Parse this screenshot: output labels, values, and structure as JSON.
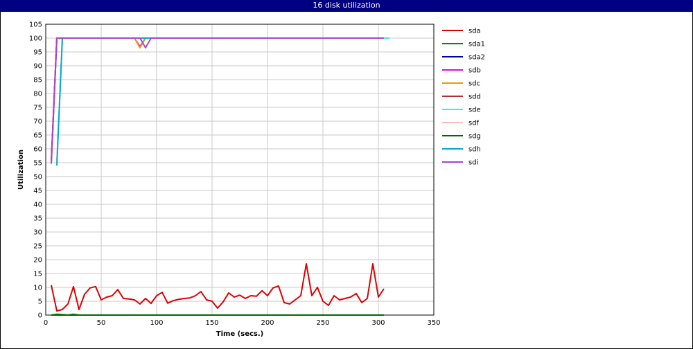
{
  "window": {
    "title": "16 disk utilization"
  },
  "chart_data": {
    "type": "line",
    "title": "16 disk utilization",
    "xlabel": "Time (secs.)",
    "ylabel": "Utilization",
    "xlim": [
      0,
      350
    ],
    "ylim": [
      0,
      105
    ],
    "xticks": [
      0,
      50,
      100,
      150,
      200,
      250,
      300,
      350
    ],
    "yticks": [
      0,
      5,
      10,
      15,
      20,
      25,
      30,
      35,
      40,
      45,
      50,
      55,
      60,
      65,
      70,
      75,
      80,
      85,
      90,
      95,
      100,
      105
    ],
    "grid": true,
    "legend_position": "right",
    "series": [
      {
        "name": "sda",
        "color": "#dd0000",
        "x": [
          5,
          10,
          15,
          20,
          25,
          30,
          35,
          40,
          45,
          50,
          55,
          60,
          65,
          70,
          75,
          80,
          85,
          90,
          95,
          100,
          105,
          110,
          115,
          120,
          125,
          130,
          135,
          140,
          145,
          150,
          155,
          160,
          165,
          170,
          175,
          180,
          185,
          190,
          195,
          200,
          205,
          210,
          215,
          220,
          225,
          230,
          235,
          240,
          245,
          250,
          255,
          260,
          265,
          270,
          275,
          280,
          285,
          290,
          295,
          300,
          305
        ],
        "y": [
          10.8,
          1.5,
          2,
          4,
          10.3,
          2,
          7.5,
          9.8,
          10.3,
          5.5,
          6.5,
          7,
          9.2,
          6,
          5.8,
          5.5,
          4,
          6,
          4.2,
          7,
          8.2,
          4.3,
          5.2,
          5.7,
          6,
          6.2,
          7,
          8.5,
          5.5,
          5,
          2.5,
          4.8,
          8,
          6.5,
          7.2,
          6,
          7,
          6.8,
          8.8,
          7,
          9.8,
          10.5,
          4.5,
          4,
          5.5,
          7,
          18.5,
          7,
          10,
          5,
          3.5,
          7,
          5.5,
          6,
          6.5,
          7.8,
          4.5,
          6,
          18.5,
          6.5,
          9.5
        ]
      },
      {
        "name": "sda1",
        "color": "#008800",
        "x": [
          5,
          10,
          15,
          20,
          25,
          30,
          100,
          200,
          305
        ],
        "y": [
          0,
          0.3,
          0.2,
          0,
          0.3,
          0,
          0,
          0,
          0
        ]
      },
      {
        "name": "sda2",
        "color": "#0000aa",
        "x": [
          5,
          305
        ],
        "y": [
          0,
          0
        ]
      },
      {
        "name": "sdb",
        "color": "#ee00ee",
        "x": [
          5,
          10,
          15,
          30,
          50,
          70,
          80,
          85,
          90,
          95,
          100,
          150,
          200,
          250,
          305
        ],
        "y": [
          56,
          100,
          100,
          100,
          100,
          100,
          100,
          97,
          100,
          100,
          100,
          100,
          100,
          100,
          100
        ]
      },
      {
        "name": "sdc",
        "color": "#ee9900",
        "x": [
          5,
          10,
          50,
          80,
          85,
          90,
          305
        ],
        "y": [
          54.5,
          100,
          100,
          100,
          96.5,
          100,
          100
        ]
      },
      {
        "name": "sdd",
        "color": "#aa3333",
        "x": [
          5,
          10,
          305
        ],
        "y": [
          55,
          100,
          100
        ]
      },
      {
        "name": "sde",
        "color": "#33eeee",
        "x": [
          10,
          15,
          100,
          200,
          305,
          310
        ],
        "y": [
          55,
          100,
          100,
          100,
          100,
          100
        ]
      },
      {
        "name": "sdf",
        "color": "#ffbbbb",
        "x": [
          10,
          15,
          305
        ],
        "y": [
          55,
          100,
          100
        ]
      },
      {
        "name": "sdg",
        "color": "#006600",
        "x": [
          5,
          305
        ],
        "y": [
          0,
          0
        ]
      },
      {
        "name": "sdh",
        "color": "#00aacc",
        "x": [
          10,
          15,
          100,
          200,
          305
        ],
        "y": [
          54,
          100,
          100,
          100,
          100
        ]
      },
      {
        "name": "sdi",
        "color": "#aa44cc",
        "x": [
          5,
          10,
          85,
          90,
          95,
          100,
          305
        ],
        "y": [
          55,
          100,
          100,
          96.5,
          100,
          100,
          100
        ]
      }
    ]
  }
}
